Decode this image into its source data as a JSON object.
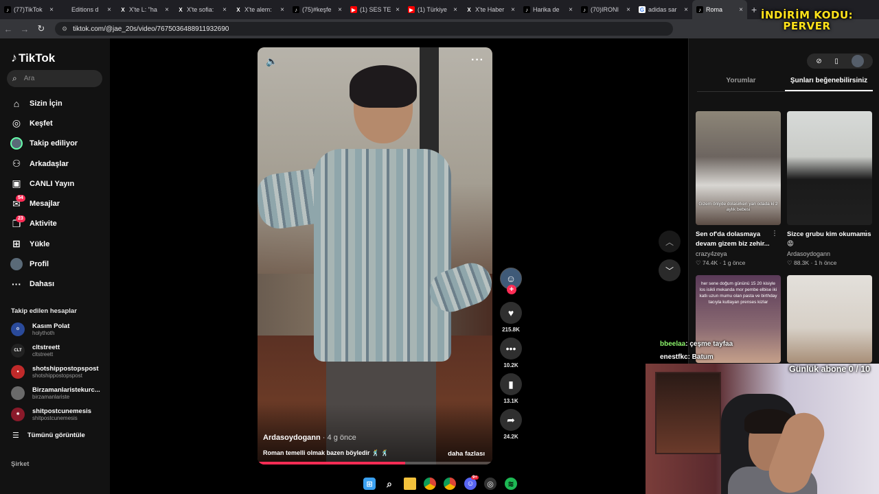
{
  "browser": {
    "tabs": [
      {
        "title": "(77)TikTok",
        "favicon": "tiktok-icon"
      },
      {
        "title": "Editions d",
        "favicon": "none"
      },
      {
        "title": "X'te L: \"ha",
        "favicon": "x-icon"
      },
      {
        "title": "X'te sofia:",
        "favicon": "x-icon"
      },
      {
        "title": "X'te alem:",
        "favicon": "x-icon"
      },
      {
        "title": "(75)#keşfe",
        "favicon": "tiktok-icon"
      },
      {
        "title": "(1) SES TE",
        "favicon": "youtube-icon"
      },
      {
        "title": "(1) Türkiye",
        "favicon": "youtube-icon"
      },
      {
        "title": "X'te Haber",
        "favicon": "x-icon"
      },
      {
        "title": "Harika de",
        "favicon": "tiktok-icon"
      },
      {
        "title": "(70)IRONI",
        "favicon": "tiktok-icon"
      },
      {
        "title": "adidas sar",
        "favicon": "google-icon"
      },
      {
        "title": "Roma",
        "favicon": "tiktok-icon",
        "active": true
      }
    ],
    "new_tab": "+",
    "url": "tiktok.com/@jae_20s/video/7675036488911932690"
  },
  "promo": {
    "line1": "İNDİRİM KODU:",
    "line2": "PERVER"
  },
  "sidebar": {
    "logo": "TikTok",
    "search_placeholder": "Ara",
    "nav": [
      {
        "label": "Sizin İçin",
        "icon": "home-icon"
      },
      {
        "label": "Keşfet",
        "icon": "compass-icon"
      },
      {
        "label": "Takip ediliyor",
        "icon": "avatar-icon"
      },
      {
        "label": "Arkadaşlar",
        "icon": "friends-icon"
      },
      {
        "label": "CANLI Yayın",
        "icon": "live-icon"
      },
      {
        "label": "Mesajlar",
        "icon": "message-icon",
        "badge": "54"
      },
      {
        "label": "Aktivite",
        "icon": "activity-icon",
        "badge": "23"
      },
      {
        "label": "Yükle",
        "icon": "upload-icon"
      },
      {
        "label": "Profil",
        "icon": "profile-avatar-icon"
      },
      {
        "label": "Dahası",
        "icon": "more-icon"
      }
    ],
    "following_title": "Takip edilen hesaplar",
    "following": [
      {
        "name": "Kasım Polat",
        "handle": "holythoth"
      },
      {
        "name": "cltstreett",
        "handle": "cltstreett"
      },
      {
        "name": "shotshippostopspost",
        "handle": "shotshippostopspost"
      },
      {
        "name": "Birzamanlaristekurc...",
        "handle": "birzamanlariste"
      },
      {
        "name": "shitpostcunemesis",
        "handle": "shitpostcunemesis"
      }
    ],
    "see_all": "Tümünü görüntüle",
    "company": "Şirket"
  },
  "video": {
    "author": "Ardasoydogann",
    "ago": "· 4 g önce",
    "caption": "Roman temelli olmak bazen böyledir",
    "caption_emoji": "🕺 🕺",
    "more": "daha fazlası",
    "progress": 0.63
  },
  "actions": {
    "likes": "215.8K",
    "comments": "10.2K",
    "saves": "13.1K",
    "shares": "24.2K"
  },
  "right_panel": {
    "tabs": [
      "Yorumlar",
      "Şunları beğenebilirsiniz"
    ],
    "active_tab": 1,
    "cards": [
      {
        "title": "Sen of'da dolasmaya devam gizem biz zehir...",
        "user": "crazy4zeya",
        "likes": "♡ 74.4K",
        "ago": "1 g önce",
        "overlay": "Gizem önlyde dolasirken yan odada ki 2 aylık bebesi"
      },
      {
        "title": "Sizce grubu kim okumamıs 😡",
        "user": "Ardasoydogann",
        "likes": "♡ 88.3K",
        "ago": "1 h önce",
        "overlay": ""
      },
      {
        "title": "",
        "user": "",
        "likes": "",
        "ago": "",
        "overlay": "her sene doğum gününü 15 20 kisiyle los isikli mekanda mor pembe elbise iki katlı uzun mumu olan pasta ve birthday tacıyla kutlayan prenses kizlar"
      },
      {
        "title": "",
        "user": "",
        "likes": "",
        "ago": "",
        "overlay": ""
      }
    ]
  },
  "stream": {
    "chat": [
      {
        "user": "bbeelaa",
        "text": ": çeşme tayfaa"
      },
      {
        "user": "enestfkc",
        "text": ": Batum"
      }
    ],
    "subgoal": "Günlük abone 0 / 10"
  },
  "colors": {
    "accent": "#fe2c55",
    "promo": "#ffe21a",
    "chat_user": "#8cf56b"
  }
}
